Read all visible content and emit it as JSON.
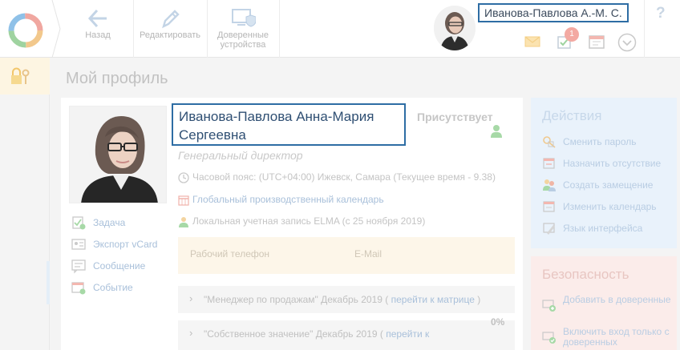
{
  "toolbar": {
    "back_label": "Назад",
    "edit_label": "Редактировать",
    "trusted_label_line1": "Доверенные",
    "trusted_label_line2": "устройства"
  },
  "user": {
    "short_name": "Иванова-Павлова А.-М. С.",
    "notification_count": "1"
  },
  "help_label": "?",
  "page": {
    "title": "Мой профиль"
  },
  "profile": {
    "full_name": "Иванова-Павлова Анна-Мария Сергеевна",
    "status": "Присутствует",
    "position": "Генеральный директор",
    "timezone": "Часовой пояс: (UTC+04:00) Ижевск, Самара (Текущее время - 9.38)",
    "calendar_link": "Глобальный производственный календарь",
    "account": "Локальная учетная запись ELMA  (с 25 ноября 2019)",
    "phone_label": "Рабочий телефон",
    "email_label": "E-Mail"
  },
  "left_actions": [
    {
      "label": "Задача"
    },
    {
      "label": "Экспорт vCard"
    },
    {
      "label": "Сообщение"
    },
    {
      "label": "Событие"
    }
  ],
  "matrices": [
    {
      "title": "\"Менеджер по продажам\" Декабрь 2019 (",
      "link": "перейти к матрице",
      "suffix": ")"
    },
    {
      "title": "\"Собственное значение\" Декабрь 2019 (",
      "link": "перейти к",
      "suffix": ""
    }
  ],
  "matrix_percent": "0%",
  "actions_panel": {
    "title": "Действия",
    "items": [
      {
        "label": "Сменить пароль"
      },
      {
        "label": "Назначить отсутствие"
      },
      {
        "label": "Создать замещение"
      },
      {
        "label": "Изменить календарь"
      },
      {
        "label": "Язык интерфейса"
      }
    ]
  },
  "security_panel": {
    "title": "Безопасность",
    "items": [
      {
        "label": "Добавить в доверенные"
      },
      {
        "label": "Включить вход только с доверенных"
      }
    ]
  },
  "colors": {
    "highlight_border": "#2e6da4",
    "name_text": "#2f4f73",
    "actions_panel_bg": "#e9f2fb",
    "security_panel_bg": "#fbecea"
  }
}
